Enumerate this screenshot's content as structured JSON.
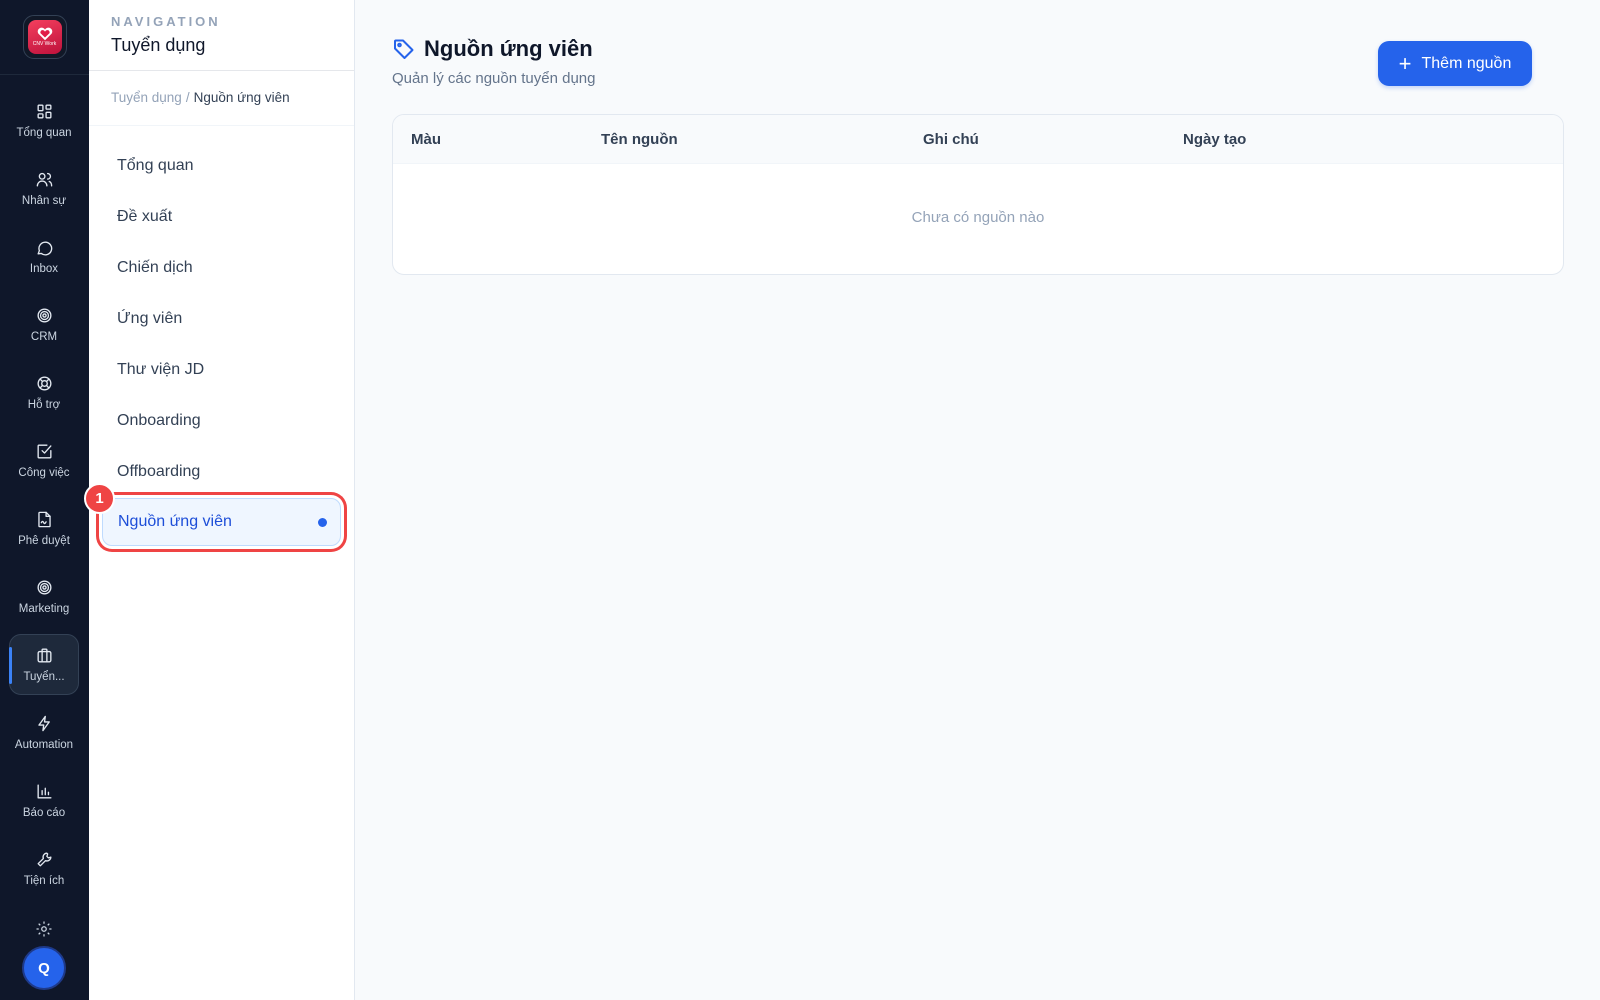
{
  "app": {
    "logo_text": "CNV Work",
    "avatar_initial": "Q"
  },
  "rail": {
    "items": [
      {
        "label": "Tổng quan",
        "icon": "grid-icon"
      },
      {
        "label": "Nhân sự",
        "icon": "users-icon"
      },
      {
        "label": "Inbox",
        "icon": "chat-bubble-icon"
      },
      {
        "label": "CRM",
        "icon": "target-icon"
      },
      {
        "label": "Hỗ trợ",
        "icon": "lifebuoy-icon"
      },
      {
        "label": "Công việc",
        "icon": "check-square-icon"
      },
      {
        "label": "Phê duyệt",
        "icon": "file-sign-icon"
      },
      {
        "label": "Marketing",
        "icon": "target-icon"
      },
      {
        "label": "Tuyển...",
        "icon": "briefcase-icon",
        "active": true
      },
      {
        "label": "Automation",
        "icon": "lightning-icon"
      },
      {
        "label": "Báo cáo",
        "icon": "bar-chart-icon"
      },
      {
        "label": "Tiện ích",
        "icon": "wrench-icon"
      }
    ],
    "settings_icon": "gear-icon"
  },
  "nav": {
    "eyebrow": "NAVIGATION",
    "title": "Tuyển dụng",
    "breadcrumb": {
      "root": "Tuyển dụng",
      "separator": "/",
      "current": "Nguồn ứng viên"
    },
    "items": [
      {
        "label": "Tổng quan"
      },
      {
        "label": "Đề xuất"
      },
      {
        "label": "Chiến dịch"
      },
      {
        "label": "Ứng viên"
      },
      {
        "label": "Thư viện JD"
      },
      {
        "label": "Onboarding"
      },
      {
        "label": "Offboarding"
      },
      {
        "label": "Nguồn ứng viên",
        "active": true
      }
    ],
    "marker": "1"
  },
  "main": {
    "title": "Nguồn ứng viên",
    "title_icon": "tag-icon",
    "subtitle": "Quản lý các nguồn tuyển dụng",
    "add_button": "Thêm nguồn",
    "table": {
      "columns": [
        "Màu",
        "Tên nguồn",
        "Ghi chú",
        "Ngày tạo"
      ],
      "empty_text": "Chưa có nguồn nào"
    }
  },
  "colors": {
    "rail_bg": "#0f172a",
    "accent": "#2563eb",
    "highlight": "#ef4444"
  }
}
